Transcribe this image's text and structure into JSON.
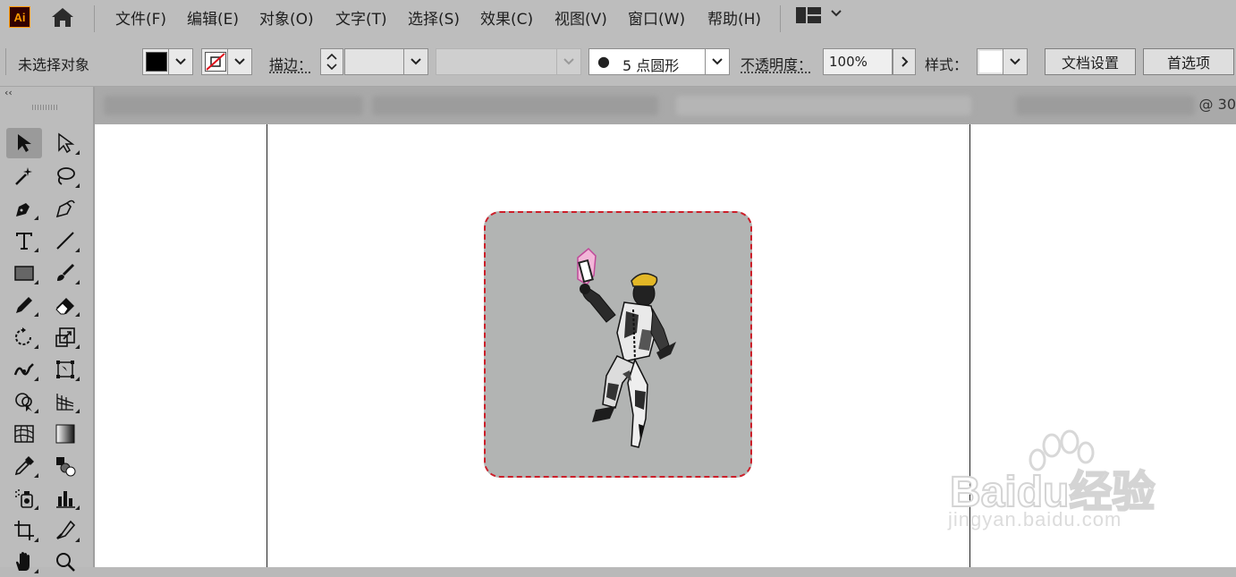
{
  "app": {
    "logo": "Ai",
    "home_icon": "home-icon"
  },
  "menu": [
    {
      "label": "文件(F)"
    },
    {
      "label": "编辑(E)"
    },
    {
      "label": "对象(O)"
    },
    {
      "label": "文字(T)"
    },
    {
      "label": "选择(S)"
    },
    {
      "label": "效果(C)"
    },
    {
      "label": "视图(V)"
    },
    {
      "label": "窗口(W)"
    },
    {
      "label": "帮助(H)"
    }
  ],
  "control": {
    "selection_status": "未选择对象",
    "fill_color": "#000000",
    "stroke": "none",
    "stroke_label": "描边：",
    "brush_value": "5 点圆形",
    "opacity_label": "不透明度：",
    "opacity_value": "100%",
    "style_label": "样式：",
    "doc_settings": "文档设置",
    "preferences": "首选项"
  },
  "document": {
    "zoom_partial": "@ 30"
  },
  "artboard": {
    "shape_fill": "#b2b4b3",
    "shape_dash_color": "#cc1f2a"
  },
  "watermark": {
    "brand": "Baidu经验",
    "url": "jingyan.baidu.com"
  }
}
